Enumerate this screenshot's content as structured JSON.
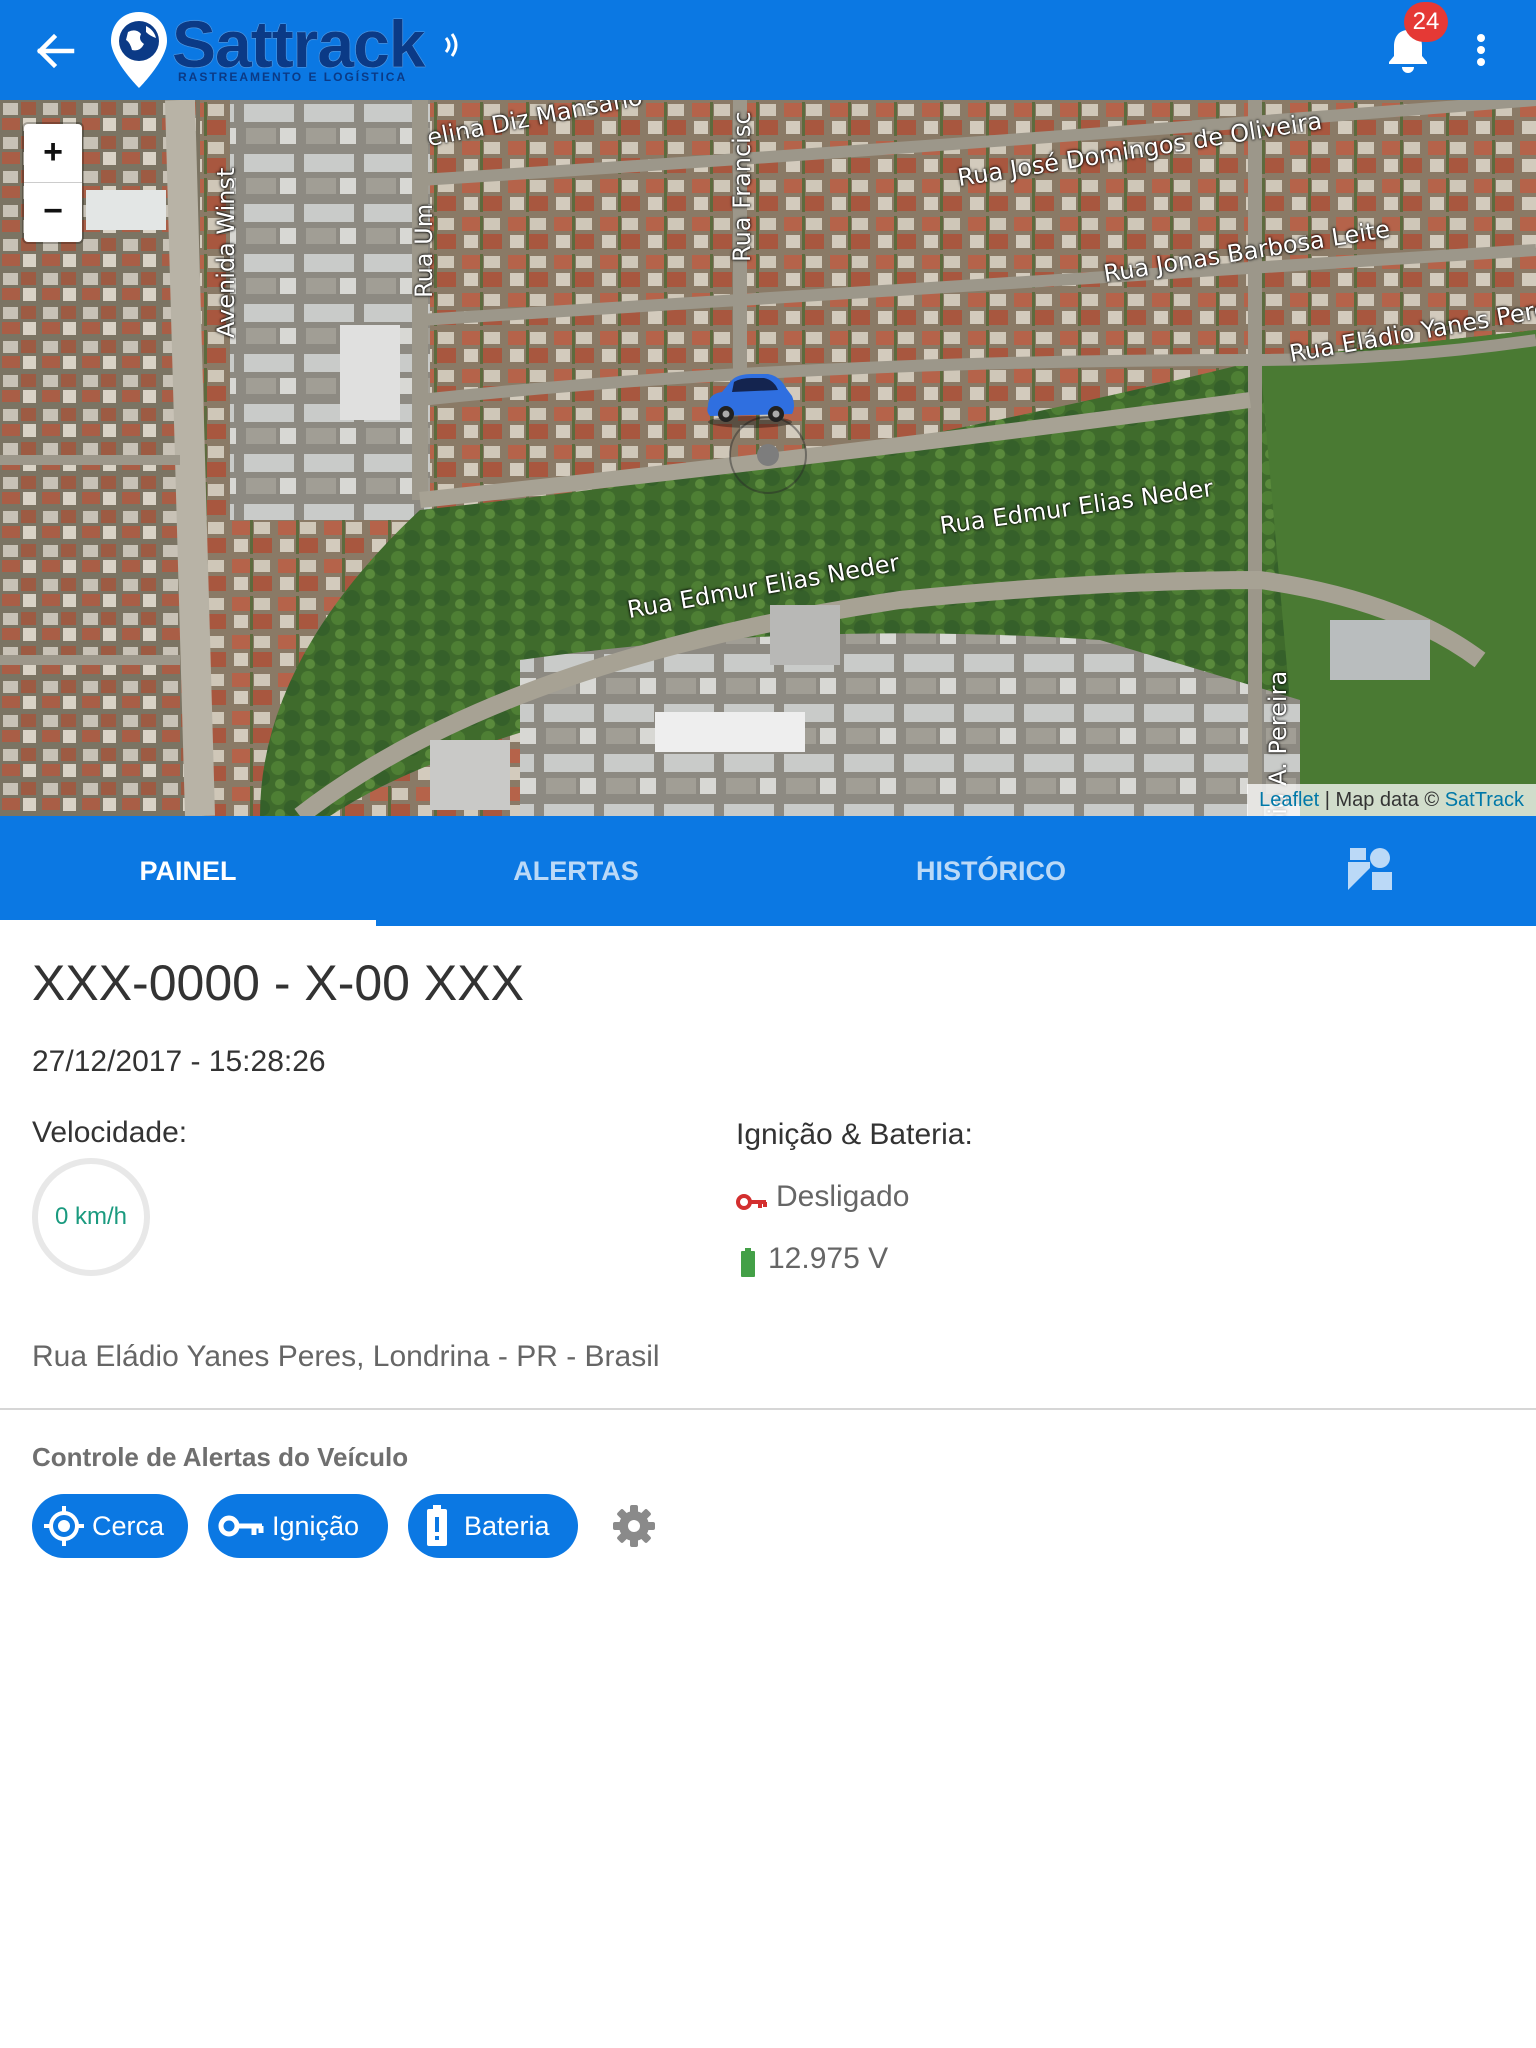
{
  "header": {
    "logo_title": "Sattrack",
    "logo_subtitle": "RASTREAMENTO E LOGÍSTICA",
    "notification_count": "24",
    "brand_color": "#0b78e3"
  },
  "map": {
    "zoom_in": "+",
    "zoom_out": "−",
    "streets": [
      "elina Diz Mansano",
      "Rua José Domingos de Oliveira",
      "Rua Jonas Barbosa Leite",
      "Rua Eládio Yanes Pere",
      "Avenida Winst",
      "Rua Um",
      "Rua Francisc",
      "Rua Edmur Elias Neder",
      "Rua Edmur Elias Neder",
      "cio A. Pereira"
    ],
    "attribution": {
      "leaflet": "Leaflet",
      "separator": "| Map data ©",
      "source": "SatTrack"
    }
  },
  "tabs": [
    {
      "label": "PAINEL",
      "active": true
    },
    {
      "label": "ALERTAS",
      "active": false
    },
    {
      "label": "HISTÓRICO",
      "active": false
    }
  ],
  "vehicle": {
    "plate": "XXX-0000 - X-00 XXX",
    "datetime": "27/12/2017 - 15:28:26",
    "speed_label": "Velocidade:",
    "speed_value": "0 km/h",
    "ign_label": "Ignição & Bateria:",
    "ignition_status": "Desligado",
    "battery_voltage": "12.975 V",
    "address": "Rua Eládio Yanes Peres, Londrina - PR - Brasil"
  },
  "alerts_control": {
    "title": "Controle de Alertas do Veículo",
    "chips": [
      "Cerca",
      "Ignição",
      "Bateria"
    ]
  },
  "icons": {
    "back": "arrow-left-icon",
    "bell": "bell-icon",
    "menu": "more-vert-icon",
    "shapes_tab": "shapes-icon",
    "key": "key-icon",
    "battery": "battery-icon",
    "gear": "gear-icon"
  }
}
